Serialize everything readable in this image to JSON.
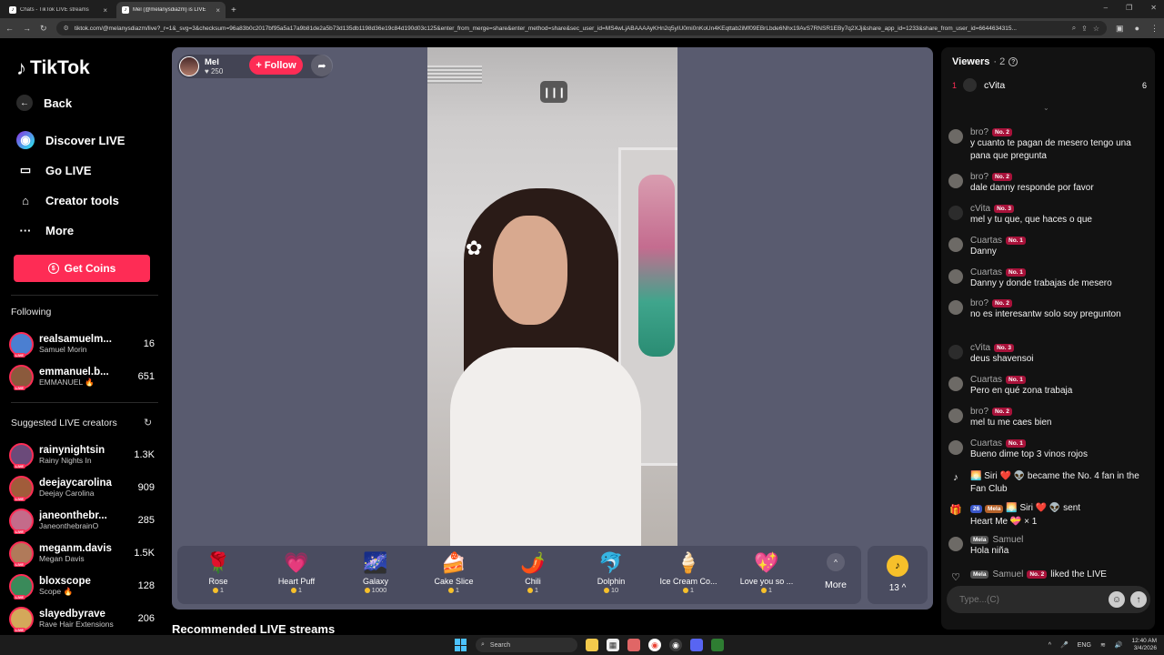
{
  "browser": {
    "tabs": [
      {
        "title": "Chats - TikTok LIVE streams",
        "active": false
      },
      {
        "title": "Mel (@melanysdiazm) is LIVE",
        "active": true
      }
    ],
    "url": "tiktok.com/@melanysdiazm/live?_r=1&_svg=3&checksum=96a83b0c2017bf95a5a17a9b81de2a5b73d135db1198d36e19c84d190d03c125&enter_from_merge=share&enter_method=share&sec_user_id=MS4wLjABAAAAyKHn2q5yIU0mi0nKoUn4KEqttab2iMf09EBrLbde6Nhx19AvS7RNSR1EBy7q2XJj&share_app_id=1233&share_from_user_id=6644634315..."
  },
  "sidebar": {
    "logo": "TikTok",
    "menu": [
      {
        "label": "Back",
        "icon": "arrow-left-icon"
      },
      {
        "label": "Discover LIVE",
        "icon": "live-globe-icon"
      },
      {
        "label": "Go LIVE",
        "icon": "camera-icon"
      },
      {
        "label": "Creator tools",
        "icon": "home-icon"
      },
      {
        "label": "More",
        "icon": "ellipsis-icon"
      }
    ],
    "coins_button": "Get Coins",
    "following_title": "Following",
    "following": [
      {
        "name": "realsamuelm...",
        "sub": "Samuel Morin",
        "count": "16",
        "color": "#4b7fd1"
      },
      {
        "name": "emmanuel.b...",
        "sub": "EMMANUEL 🔥",
        "count": "651",
        "color": "#8b5a3c"
      }
    ],
    "suggested_title": "Suggested LIVE creators",
    "suggested": [
      {
        "name": "rainynightsin",
        "sub": "Rainy Nights In",
        "count": "1.3K",
        "color": "#6b4a7a"
      },
      {
        "name": "deejaycarolina",
        "sub": "Deejay Carolina",
        "count": "909",
        "color": "#a15c3a"
      },
      {
        "name": "janeonthebr...",
        "sub": "JaneonthebrainO",
        "count": "285",
        "color": "#c46b8a"
      },
      {
        "name": "meganm.davis",
        "sub": "Megan Davis",
        "count": "1.5K",
        "color": "#b07a5a"
      },
      {
        "name": "bloxscope",
        "sub": "Scope 🔥",
        "count": "128",
        "color": "#3a8a5a"
      },
      {
        "name": "slayedbyrave",
        "sub": "Rave Hair Extensions",
        "count": "206",
        "color": "#d4a85a"
      }
    ]
  },
  "player": {
    "host_name": "Mel",
    "host_likes": "♥ 250",
    "follow_label": "+ Follow",
    "gifts": [
      {
        "name": "Rose",
        "price": "1",
        "icon": "🌹"
      },
      {
        "name": "Heart Puff",
        "price": "1",
        "icon": "💗"
      },
      {
        "name": "Galaxy",
        "price": "1000",
        "icon": "🌌"
      },
      {
        "name": "Cake Slice",
        "price": "1",
        "icon": "🍰"
      },
      {
        "name": "Chili",
        "price": "1",
        "icon": "🌶️"
      },
      {
        "name": "Dolphin",
        "price": "10",
        "icon": "🐬"
      },
      {
        "name": "Ice Cream Co...",
        "price": "1",
        "icon": "🍦"
      },
      {
        "name": "Love you so ...",
        "price": "1",
        "icon": "💖"
      }
    ],
    "more_label": "More",
    "coin_count": "13 ^"
  },
  "recommended_title": "Recommended LIVE streams",
  "chat": {
    "viewers_label": "Viewers",
    "viewers_count": "· 2",
    "top_viewer": {
      "rank": "1",
      "name": "cVita",
      "score": "6"
    },
    "input_placeholder": "Type...(C)",
    "messages": [
      {
        "user": "bro?",
        "badge": "No. 2",
        "text": "y cuanto te pagan de mesero tengo una pana que pregunta"
      },
      {
        "user": "bro?",
        "badge": "No. 2",
        "text": "dale danny responde por favor"
      },
      {
        "user": "cVita",
        "badge": "No. 3",
        "text": "mel y tu que, que haces o que"
      },
      {
        "user": "Cuartas",
        "badge": "No. 1",
        "text": "Danny"
      },
      {
        "user": "Cuartas",
        "badge": "No. 1",
        "text": "Danny y donde trabajas de mesero"
      },
      {
        "user": "bro?",
        "badge": "No. 2",
        "text": "no es interesantw solo soy pregunton"
      },
      {
        "user": "cVita",
        "badge": "No. 3",
        "text": "deus shavensoi"
      },
      {
        "user": "Cuartas",
        "badge": "No. 1",
        "text": "Pero en qué zona trabaja"
      },
      {
        "user": "bro?",
        "badge": "No. 2",
        "text": "mel tu me caes bien"
      },
      {
        "user": "Cuartas",
        "badge": "No. 1",
        "text": "Bueno dime top 3 vinos rojos"
      }
    ],
    "system1": "🌅 Siri ❤️ 👽 became the No. 4 fan in the Fan Club",
    "gift_msg": {
      "badge1": "26",
      "badge2": "Mela",
      "text": "🌅 Siri ❤️ 👽 sent",
      "text2": "Heart Me 💝 × 1"
    },
    "samuel": {
      "badge": "Mela",
      "user": "Samuel",
      "text": "Hola niña"
    },
    "like_msg": {
      "badge": "Mela",
      "user": "Samuel",
      "badge2": "No. 2",
      "text": "liked the LIVE"
    }
  },
  "taskbar": {
    "search": "Search",
    "lang": "ENG",
    "time": "12:40 AM",
    "date": "3/4/2026"
  }
}
